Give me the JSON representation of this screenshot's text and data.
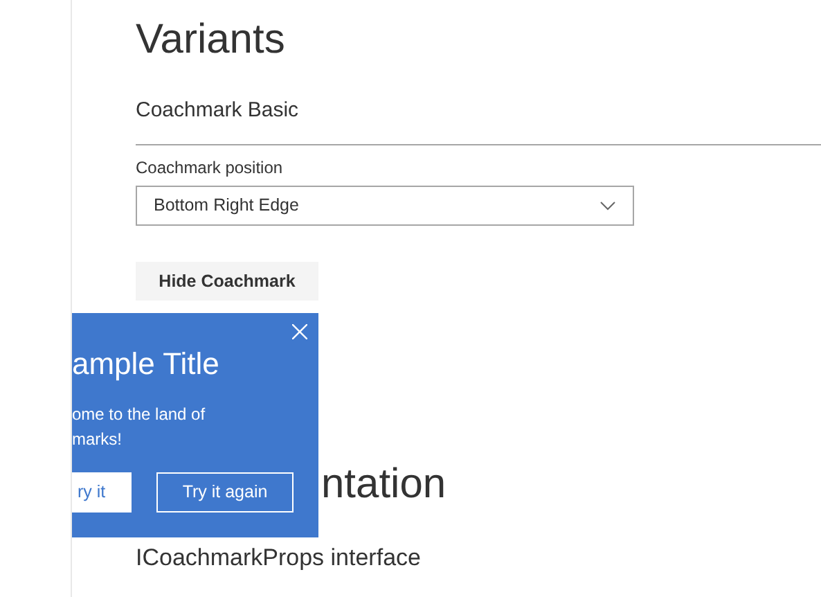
{
  "page_title": "Variants",
  "example_title": "Coachmark Basic",
  "dropdown": {
    "label": "Coachmark position",
    "value": "Bottom Right Edge",
    "expanded": false
  },
  "hide_button": "Hide Coachmark",
  "coachmark": {
    "title": "ample Title",
    "body_lines": [
      "ome to the land of",
      "marks!"
    ],
    "buttons": [
      {
        "label": "ry it",
        "primary": true
      },
      {
        "label": "Try it again",
        "primary": false
      }
    ]
  },
  "section_heading": "ntation",
  "subheading": "ICoachmarkProps interface"
}
